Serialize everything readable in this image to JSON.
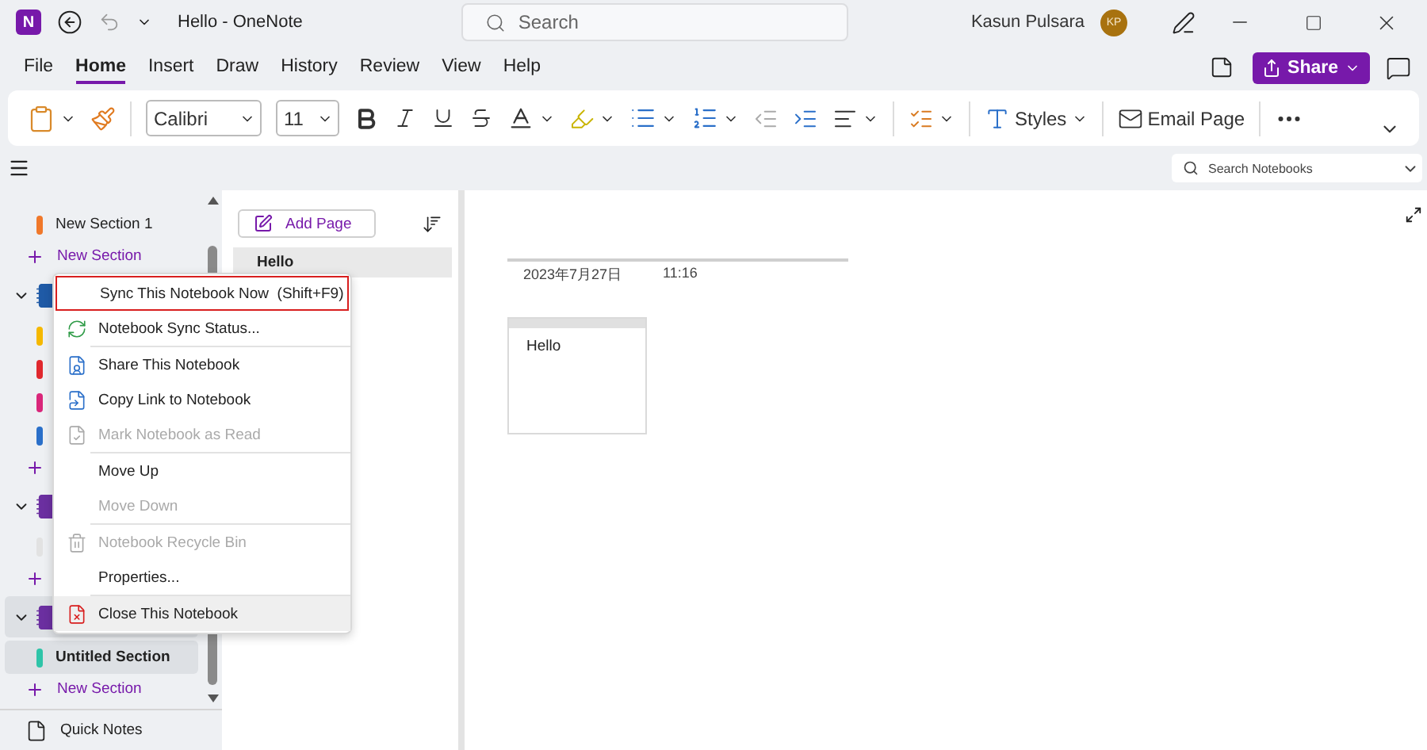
{
  "window": {
    "logo_letter": "N",
    "title": "Hello - OneNote"
  },
  "search": {
    "placeholder": "Search"
  },
  "user": {
    "name": "Kasun Pulsara",
    "initials": "KP"
  },
  "tabs": [
    {
      "label": "File",
      "selected": false
    },
    {
      "label": "Home",
      "selected": true
    },
    {
      "label": "Insert",
      "selected": false
    },
    {
      "label": "Draw",
      "selected": false
    },
    {
      "label": "History",
      "selected": false
    },
    {
      "label": "Review",
      "selected": false
    },
    {
      "label": "View",
      "selected": false
    },
    {
      "label": "Help",
      "selected": false
    }
  ],
  "share_button": "Share",
  "ribbon": {
    "font": "Calibri",
    "size": "11",
    "styles": "Styles",
    "email": "Email Page"
  },
  "notebook_search": {
    "placeholder": "Search Notebooks"
  },
  "sidebar": {
    "groups": [
      {
        "kind": "sections",
        "add_label": "New Section",
        "sections": [
          {
            "name": "New Section 1",
            "color": "#f0782a",
            "selected": false
          }
        ]
      },
      {
        "kind": "notebook",
        "color": "#1f5aa6",
        "expanded": true,
        "selected": false,
        "sections": [
          {
            "color": "#f5b800",
            "selected": false
          },
          {
            "color": "#e0282e",
            "selected": false
          },
          {
            "color": "#d9267a",
            "selected": false
          },
          {
            "color": "#2a6fc9",
            "selected": false
          }
        ]
      },
      {
        "kind": "notebook",
        "color": "#6b2fa0",
        "expanded": true,
        "selected": false,
        "sections": [
          {
            "color": "#e2e2e2",
            "selected": false
          }
        ]
      },
      {
        "kind": "notebook",
        "color": "#6b2fa0",
        "expanded": true,
        "selected": true,
        "add_label": "New Section",
        "sections": [
          {
            "name": "Untitled Section",
            "color": "#2ec4a8",
            "selected": true
          }
        ]
      }
    ],
    "quick_notes": "Quick Notes"
  },
  "pages": {
    "add_label": "Add Page",
    "items": [
      {
        "title": "Hello",
        "selected": true
      }
    ]
  },
  "note": {
    "date": "2023年7月27日",
    "time": "11:16",
    "body": "Hello"
  },
  "context_menu": {
    "items": [
      {
        "kind": "item",
        "label": "Sync This Notebook Now",
        "shortcut": "(Shift+F9)",
        "disabled": false,
        "hovered": false,
        "outlined": true
      },
      {
        "kind": "item",
        "label": "Notebook Sync Status...",
        "disabled": false,
        "hovered": false,
        "outlined": false
      },
      {
        "kind": "separator"
      },
      {
        "kind": "item",
        "label": "Share This Notebook",
        "disabled": false,
        "hovered": false,
        "outlined": false
      },
      {
        "kind": "item",
        "label": "Copy Link to Notebook",
        "disabled": false,
        "hovered": false,
        "outlined": false
      },
      {
        "kind": "item",
        "label": "Mark Notebook as Read",
        "disabled": true,
        "hovered": false,
        "outlined": false
      },
      {
        "kind": "separator"
      },
      {
        "kind": "item",
        "label": "Move Up",
        "disabled": false,
        "hovered": false,
        "outlined": false
      },
      {
        "kind": "item",
        "label": "Move Down",
        "disabled": true,
        "hovered": false,
        "outlined": false
      },
      {
        "kind": "separator"
      },
      {
        "kind": "item",
        "label": "Notebook Recycle Bin",
        "disabled": true,
        "hovered": false,
        "outlined": false
      },
      {
        "kind": "item",
        "label": "Properties...",
        "disabled": false,
        "hovered": false,
        "outlined": false
      },
      {
        "kind": "separator"
      },
      {
        "kind": "item",
        "label": "Close This Notebook",
        "disabled": false,
        "hovered": true,
        "outlined": false
      }
    ]
  }
}
